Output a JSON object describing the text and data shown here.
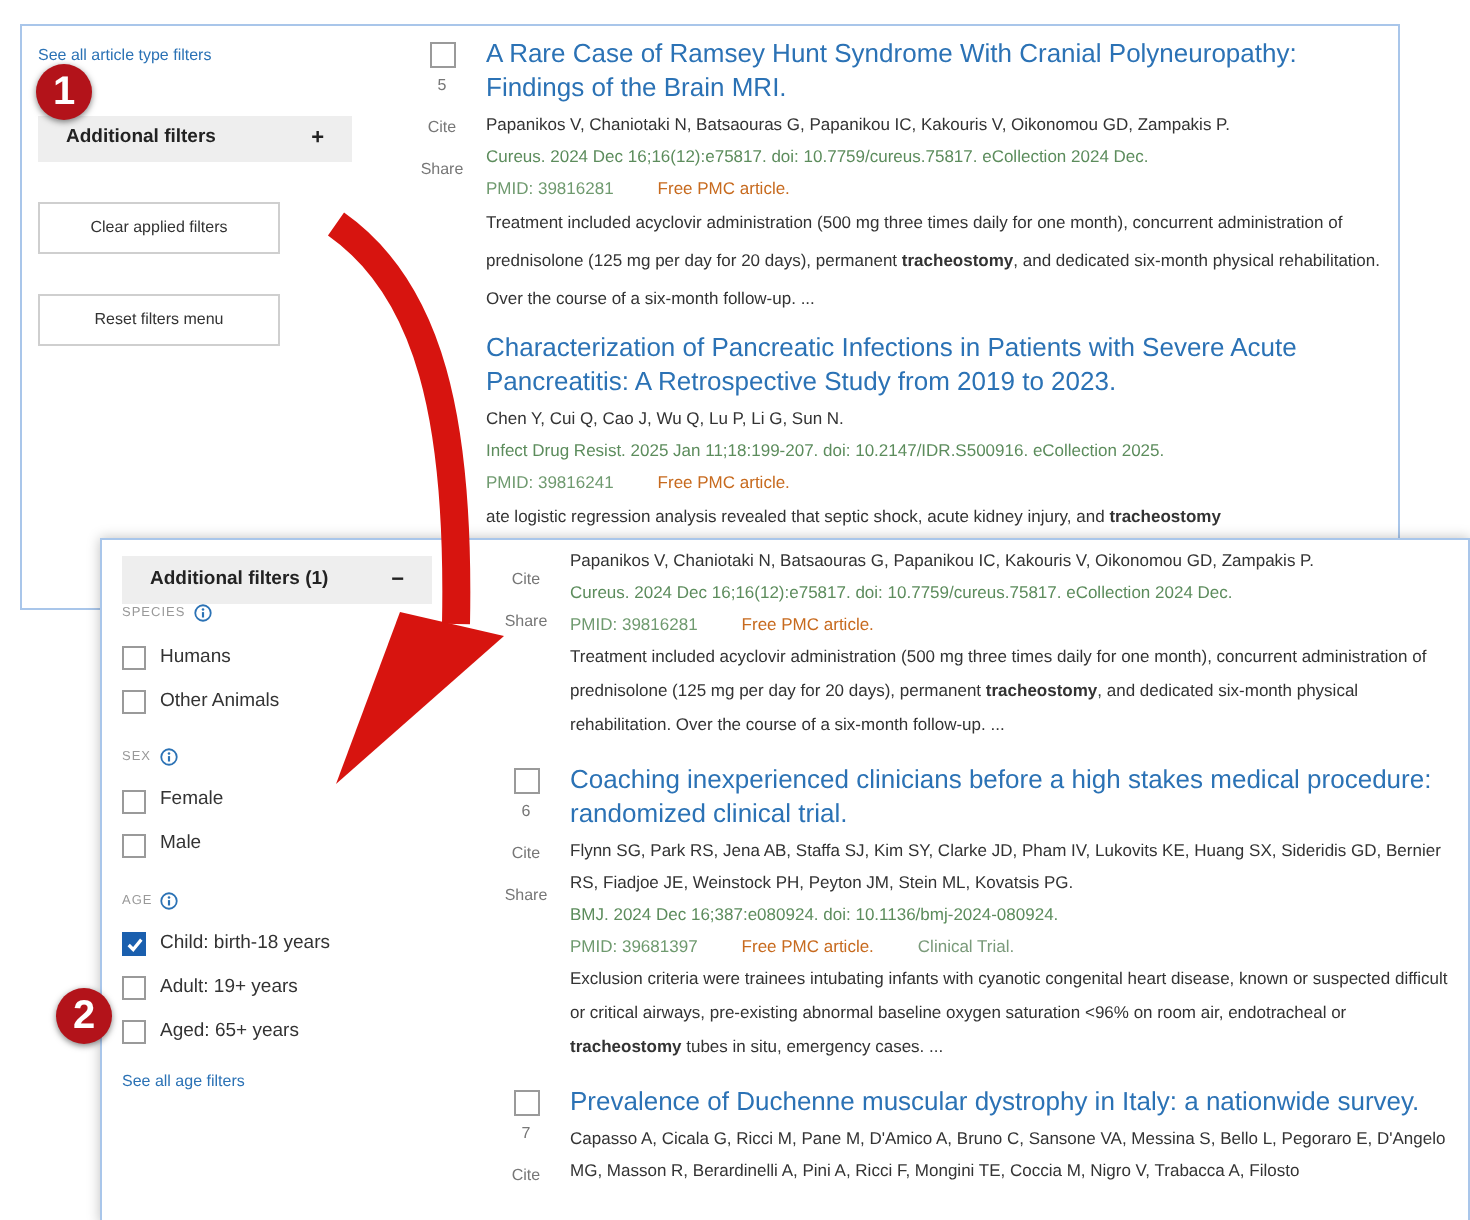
{
  "top_panel": {
    "sidebar": {
      "link": "See all article type filters",
      "toggle": {
        "label": "Additional filters",
        "symbol": "+"
      },
      "buttons": [
        "Clear applied filters",
        "Reset filters menu"
      ]
    },
    "results": [
      {
        "checked": false,
        "number": "5",
        "actions": [
          "Cite",
          "Share"
        ],
        "title": "A Rare Case of Ramsey Hunt Syndrome With Cranial Polyneuropathy: Findings of the Brain MRI.",
        "authors": "Papanikos V, Chaniotaki N, Batsaouras G, Papanikou IC, Kakouris V, Oikonomou GD, Zampakis P.",
        "citation": "Cureus. 2024 Dec 16;16(12):e75817. doi: 10.7759/cureus.75817. eCollection 2024 Dec.",
        "pmid": "PMID: 39816281",
        "badges": [
          {
            "kind": "free",
            "text": "Free PMC article."
          }
        ],
        "snippet": "Treatment included acyclovir administration (500 mg three times daily for one month), concurrent administration of prednisolone (125 mg per day for 20 days), permanent **tracheostomy**, and dedicated six-month physical rehabilitation. Over the course of a six-month follow-up. ..."
      },
      {
        "title": "Characterization of Pancreatic Infections in Patients with Severe Acute Pancreatitis: A Retrospective Study from 2019 to 2023.",
        "authors": "Chen Y, Cui Q, Cao J, Wu Q, Lu P, Li G, Sun N.",
        "citation": "Infect Drug Resist. 2025 Jan 11;18:199-207. doi: 10.2147/IDR.S500916. eCollection 2025.",
        "pmid": "PMID: 39816241",
        "badges": [
          {
            "kind": "free",
            "text": "Free PMC article."
          }
        ],
        "snippet": "ate logistic regression analysis revealed that septic shock, acute kidney injury, and **tracheostomy**"
      }
    ]
  },
  "bottom_panel": {
    "sidebar": {
      "toggle": {
        "label": "Additional filters (1)",
        "symbol": "−"
      },
      "groups": [
        {
          "heading": "SPECIES",
          "options": [
            {
              "label": "Humans",
              "checked": false
            },
            {
              "label": "Other Animals",
              "checked": false
            }
          ]
        },
        {
          "heading": "SEX",
          "options": [
            {
              "label": "Female",
              "checked": false
            },
            {
              "label": "Male",
              "checked": false
            }
          ]
        },
        {
          "heading": "AGE",
          "options": [
            {
              "label": "Child: birth-18 years",
              "checked": true
            },
            {
              "label": "Adult: 19+ years",
              "checked": false
            },
            {
              "label": "Aged: 65+ years",
              "checked": false
            }
          ]
        }
      ],
      "link": "See all age filters"
    },
    "results": [
      {
        "actions": [
          "Cite",
          "Share"
        ],
        "authors": "Papanikos V, Chaniotaki N, Batsaouras G, Papanikou IC, Kakouris V, Oikonomou GD, Zampakis P.",
        "citation": "Cureus. 2024 Dec 16;16(12):e75817. doi: 10.7759/cureus.75817. eCollection 2024 Dec.",
        "pmid": "PMID: 39816281",
        "badges": [
          {
            "kind": "free",
            "text": "Free PMC article."
          }
        ],
        "snippet": "Treatment included acyclovir administration (500 mg three times daily for one month), concurrent administration of prednisolone (125 mg per day for 20 days), permanent **tracheostomy**, and dedicated six-month physical rehabilitation. Over the course of a six-month follow-up. ..."
      },
      {
        "checked": false,
        "number": "6",
        "actions": [
          "Cite",
          "Share"
        ],
        "title": "Coaching inexperienced clinicians before a high stakes medical procedure: randomized clinical trial.",
        "authors": "Flynn SG, Park RS, Jena AB, Staffa SJ, Kim SY, Clarke JD, Pham IV, Lukovits KE, Huang SX, Sideridis GD, Bernier RS, Fiadjoe JE, Weinstock PH, Peyton JM, Stein ML, Kovatsis PG.",
        "citation": "BMJ. 2024 Dec 16;387:e080924. doi: 10.1136/bmj-2024-080924.",
        "pmid": "PMID: 39681397",
        "badges": [
          {
            "kind": "free",
            "text": "Free PMC article."
          },
          {
            "kind": "type",
            "text": "Clinical Trial."
          }
        ],
        "snippet": "Exclusion criteria were trainees intubating infants with cyanotic congenital heart disease, known or suspected difficult or critical airways, pre-existing abnormal baseline oxygen saturation <96% on room air, endotracheal or **tracheostomy** tubes in situ, emergency cases. ..."
      },
      {
        "checked": false,
        "number": "7",
        "actions": [
          "Cite"
        ],
        "title": "Prevalence of Duchenne muscular dystrophy in Italy: a nationwide survey.",
        "authors": "Capasso A, Cicala G, Ricci M, Pane M, D'Amico A, Bruno C, Sansone VA, Messina S, Bello L, Pegoraro E, D'Angelo MG, Masson R, Berardinelli A, Pini A, Ricci F, Mongini TE, Coccia M, Nigro V, Trabacca A, Filosto"
      }
    ]
  },
  "markers": [
    "1",
    "2"
  ]
}
